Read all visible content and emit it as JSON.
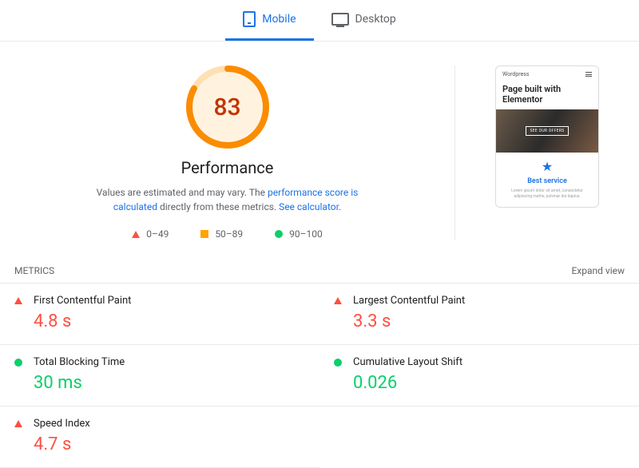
{
  "tabs": {
    "mobile": "Mobile",
    "desktop": "Desktop"
  },
  "score": {
    "value": "83",
    "label": "Performance"
  },
  "note": {
    "pre": "Values are estimated and may vary. The ",
    "link1": "performance score is calculated",
    "mid": " directly from these metrics. ",
    "link2": "See calculator",
    "post": "."
  },
  "legend": {
    "r": "0–49",
    "a": "50–89",
    "g": "90–100"
  },
  "preview": {
    "brand": "Wordpress",
    "title": "Page built with Elementor",
    "cta": "SEE OUR OFFERS",
    "service": "Best service",
    "lorem": "Lorem ipsum dolor sit amet, consectetur adipiscing mattis, pulvinar dui dapius."
  },
  "metrics": {
    "header": "METRICS",
    "expand": "Expand view",
    "fcp": {
      "name": "First Contentful Paint",
      "value": "4.8 s"
    },
    "tbt": {
      "name": "Total Blocking Time",
      "value": "30 ms"
    },
    "si": {
      "name": "Speed Index",
      "value": "4.7 s"
    },
    "lcp": {
      "name": "Largest Contentful Paint",
      "value": "3.3 s"
    },
    "cls": {
      "name": "Cumulative Layout Shift",
      "value": "0.026"
    }
  }
}
